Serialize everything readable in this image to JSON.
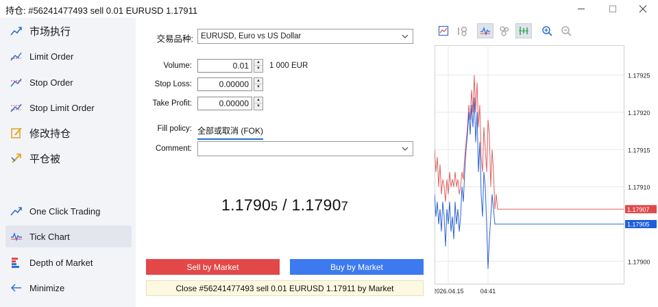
{
  "window": {
    "title": "持仓: #56241477493 sell 0.01 EURUSD 1.17911"
  },
  "sidebar": {
    "items": [
      {
        "label": "市场执行",
        "icon": "market-execution-icon"
      },
      {
        "label": "Limit Order",
        "icon": "limit-order-icon"
      },
      {
        "label": "Stop Order",
        "icon": "stop-order-icon"
      },
      {
        "label": "Stop Limit Order",
        "icon": "stop-limit-order-icon"
      },
      {
        "label": "修改持仓",
        "icon": "modify-position-icon"
      },
      {
        "label": "平仓被",
        "icon": "close-by-icon"
      },
      {
        "label": "One Click Trading",
        "icon": "one-click-trading-icon"
      },
      {
        "label": "Tick Chart",
        "icon": "tick-chart-icon"
      },
      {
        "label": "Depth of Market",
        "icon": "depth-of-market-icon"
      },
      {
        "label": "Minimize",
        "icon": "minimize-arrow-icon"
      }
    ]
  },
  "form": {
    "symbol_label": "交易品种:",
    "symbol_value": "EURUSD, Euro vs US Dollar",
    "volume_label": "Volume:",
    "volume_value": "0.01",
    "volume_unit": "1 000 EUR",
    "stoploss_label": "Stop Loss:",
    "stoploss_value": "0.00000",
    "takeprofit_label": "Take Profit:",
    "takeprofit_value": "0.00000",
    "fill_label": "Fill policy:",
    "fill_value": "全部或取消 (FOK)",
    "comment_label": "Comment:",
    "comment_value": ""
  },
  "quote": {
    "bid_main": "1.1790",
    "bid_small": "5",
    "separator": " / ",
    "ask_main": "1.1790",
    "ask_small": "7"
  },
  "buttons": {
    "sell": "Sell by Market",
    "buy": "Buy by Market",
    "close": "Close #56241477493 sell 0.01 EURUSD 1.17911 by Market"
  },
  "chart_data": {
    "type": "line",
    "title": "",
    "series": [
      {
        "color": "#e06060",
        "x": [
          0,
          2,
          4,
          6,
          8,
          10,
          12,
          14,
          16,
          18,
          20,
          22,
          24,
          26,
          28,
          30,
          32,
          34,
          36,
          38,
          40,
          42,
          44,
          46,
          48,
          50,
          52,
          54,
          56,
          58,
          60,
          62,
          64,
          66,
          68,
          70,
          72,
          74,
          76,
          78,
          80,
          82,
          84,
          86,
          88,
          90,
          92,
          94,
          96,
          98,
          100,
          102,
          104,
          106,
          108,
          110,
          112,
          114,
          116,
          118,
          120,
          122,
          124,
          126,
          128,
          130,
          132,
          134,
          136,
          138,
          140,
          142,
          144,
          146,
          148,
          150,
          152,
          154,
          156,
          158,
          160,
          162,
          164,
          166,
          168,
          170,
          172,
          174,
          176,
          178,
          180,
          182,
          184,
          186,
          188,
          190,
          192,
          194,
          196,
          198,
          200,
          202,
          204,
          206,
          208,
          210,
          212,
          214,
          216,
          218,
          220,
          222,
          224,
          226,
          228,
          230,
          232,
          234,
          236,
          238,
          240,
          242,
          244,
          246,
          248,
          250,
          252,
          254,
          256,
          258,
          260,
          262,
          264,
          266,
          268,
          270,
          272,
          274,
          276
        ],
        "y": [
          1.17915,
          1.17912,
          1.17914,
          1.1791,
          1.17913,
          1.17909,
          1.17911,
          1.1791,
          1.17908,
          1.17911,
          1.17909,
          1.17912,
          1.1791,
          1.17911,
          1.1791,
          1.17912,
          1.1791,
          1.17911,
          1.17909,
          1.1791,
          1.17912,
          1.17911,
          1.17914,
          1.17916,
          1.17918,
          1.17921,
          1.17919,
          1.17923,
          1.1792,
          1.17925,
          1.1792,
          1.17924,
          1.17918,
          1.17921,
          1.17914,
          1.17912,
          1.17918,
          1.17915,
          1.17912,
          1.17919,
          1.17917,
          1.1791,
          1.17915,
          1.17912,
          1.17907,
          1.17909,
          1.17907,
          1.17907,
          1.17907,
          1.17907,
          1.17907,
          1.17907,
          1.17907,
          1.17907,
          1.17907,
          1.17907,
          1.17907,
          1.17907,
          1.17907,
          1.17907,
          1.17907,
          1.17907,
          1.17907,
          1.17907,
          1.17907,
          1.17907,
          1.17907,
          1.17907,
          1.17907,
          1.17907,
          1.17907,
          1.17907,
          1.17907,
          1.17907,
          1.17907,
          1.17907,
          1.17907,
          1.17907,
          1.17907,
          1.17907,
          1.17907,
          1.17907,
          1.17907,
          1.17907,
          1.17907,
          1.17907,
          1.17907,
          1.17907,
          1.17907,
          1.17907,
          1.17907,
          1.17907,
          1.17907,
          1.17907,
          1.17907,
          1.17907,
          1.17907,
          1.17907,
          1.17907,
          1.17907,
          1.17907,
          1.17907,
          1.17907,
          1.17907,
          1.17907,
          1.17907,
          1.17907,
          1.17907,
          1.17907,
          1.17907,
          1.17907,
          1.17907,
          1.17907,
          1.17907,
          1.17907,
          1.17907,
          1.17907,
          1.17907,
          1.17907,
          1.17907,
          1.17907,
          1.17907,
          1.17907,
          1.17907,
          1.17907,
          1.17907,
          1.17907,
          1.17907,
          1.17907,
          1.17907,
          1.17907,
          1.17907,
          1.17907,
          1.17907,
          1.17907,
          1.17907,
          1.17907,
          1.17907,
          1.17907
        ]
      },
      {
        "color": "#2a62d4",
        "x": [
          0,
          2,
          4,
          6,
          8,
          10,
          12,
          14,
          16,
          18,
          20,
          22,
          24,
          26,
          28,
          30,
          32,
          34,
          36,
          38,
          40,
          42,
          44,
          46,
          48,
          50,
          52,
          54,
          56,
          58,
          60,
          62,
          64,
          66,
          68,
          70,
          72,
          74,
          76,
          78,
          80,
          82,
          84,
          86,
          88,
          90,
          92,
          94,
          96,
          98,
          100,
          102,
          104,
          106,
          108,
          110,
          112,
          114,
          116,
          118,
          120,
          122,
          124,
          126,
          128,
          130,
          132,
          134,
          136,
          138,
          140,
          142,
          144,
          146,
          148,
          150,
          152,
          154,
          156,
          158,
          160,
          162,
          164,
          166,
          168,
          170,
          172,
          174,
          176,
          178,
          180,
          182,
          184,
          186,
          188,
          190,
          192,
          194,
          196,
          198,
          200,
          202,
          204,
          206,
          208,
          210,
          212,
          214,
          216,
          218,
          220,
          222,
          224,
          226,
          228,
          230,
          232,
          234,
          236,
          238,
          240,
          242,
          244,
          246,
          248,
          250,
          252,
          254,
          256,
          258,
          260,
          262,
          264,
          266,
          268,
          270,
          272,
          274,
          276
        ],
        "y": [
          1.17909,
          1.17906,
          1.17908,
          1.17905,
          1.17907,
          1.17904,
          1.17908,
          1.17906,
          1.17902,
          1.17907,
          1.17905,
          1.17908,
          1.17904,
          1.17906,
          1.17903,
          1.17908,
          1.17905,
          1.17907,
          1.17904,
          1.17906,
          1.1791,
          1.17908,
          1.17912,
          1.17915,
          1.17917,
          1.1792,
          1.17917,
          1.17921,
          1.17918,
          1.17922,
          1.17916,
          1.1792,
          1.17912,
          1.17916,
          1.17909,
          1.17906,
          1.17912,
          1.1791,
          1.17905,
          1.17899,
          1.17903,
          1.17906,
          1.17909,
          1.17907,
          1.17905,
          1.17905,
          1.17905,
          1.17905,
          1.17905,
          1.17905,
          1.17905,
          1.17905,
          1.17905,
          1.17905,
          1.17905,
          1.17905,
          1.17905,
          1.17905,
          1.17905,
          1.17905,
          1.17905,
          1.17905,
          1.17905,
          1.17905,
          1.17905,
          1.17905,
          1.17905,
          1.17905,
          1.17905,
          1.17905,
          1.17905,
          1.17905,
          1.17905,
          1.17905,
          1.17905,
          1.17905,
          1.17905,
          1.17905,
          1.17905,
          1.17905,
          1.17905,
          1.17905,
          1.17905,
          1.17905,
          1.17905,
          1.17905,
          1.17905,
          1.17905,
          1.17905,
          1.17905,
          1.17905,
          1.17905,
          1.17905,
          1.17905,
          1.17905,
          1.17905,
          1.17905,
          1.17905,
          1.17905,
          1.17905,
          1.17905,
          1.17905,
          1.17905,
          1.17905,
          1.17905,
          1.17905,
          1.17905,
          1.17905,
          1.17905,
          1.17905,
          1.17905,
          1.17905,
          1.17905,
          1.17905,
          1.17905,
          1.17905,
          1.17905,
          1.17905,
          1.17905,
          1.17905,
          1.17905,
          1.17905,
          1.17905,
          1.17905,
          1.17905,
          1.17905,
          1.17905,
          1.17905,
          1.17905,
          1.17905,
          1.17905,
          1.17905,
          1.17905,
          1.17905,
          1.17905,
          1.17905,
          1.17905,
          1.17905,
          1.17905
        ]
      }
    ],
    "y_ticks": [
      "1.17925",
      "1.17920",
      "1.17915",
      "1.17910",
      "1.17905",
      "1.17900"
    ],
    "y_tick_values": [
      1.17925,
      1.1792,
      1.17915,
      1.1791,
      1.17905,
      1.179
    ],
    "ylim": [
      1.17897,
      1.17929
    ],
    "xlim": [
      0,
      276
    ],
    "x_labels": [
      "2026.04.15",
      "04:41"
    ],
    "x_label_positions": [
      20,
      78
    ],
    "ask_label": "1.17907",
    "bid_label": "1.17905",
    "ask_value": 1.17907,
    "bid_value": 1.17905,
    "ask_color": "#e04a4a",
    "bid_color": "#1f5ed8",
    "grid": true
  }
}
